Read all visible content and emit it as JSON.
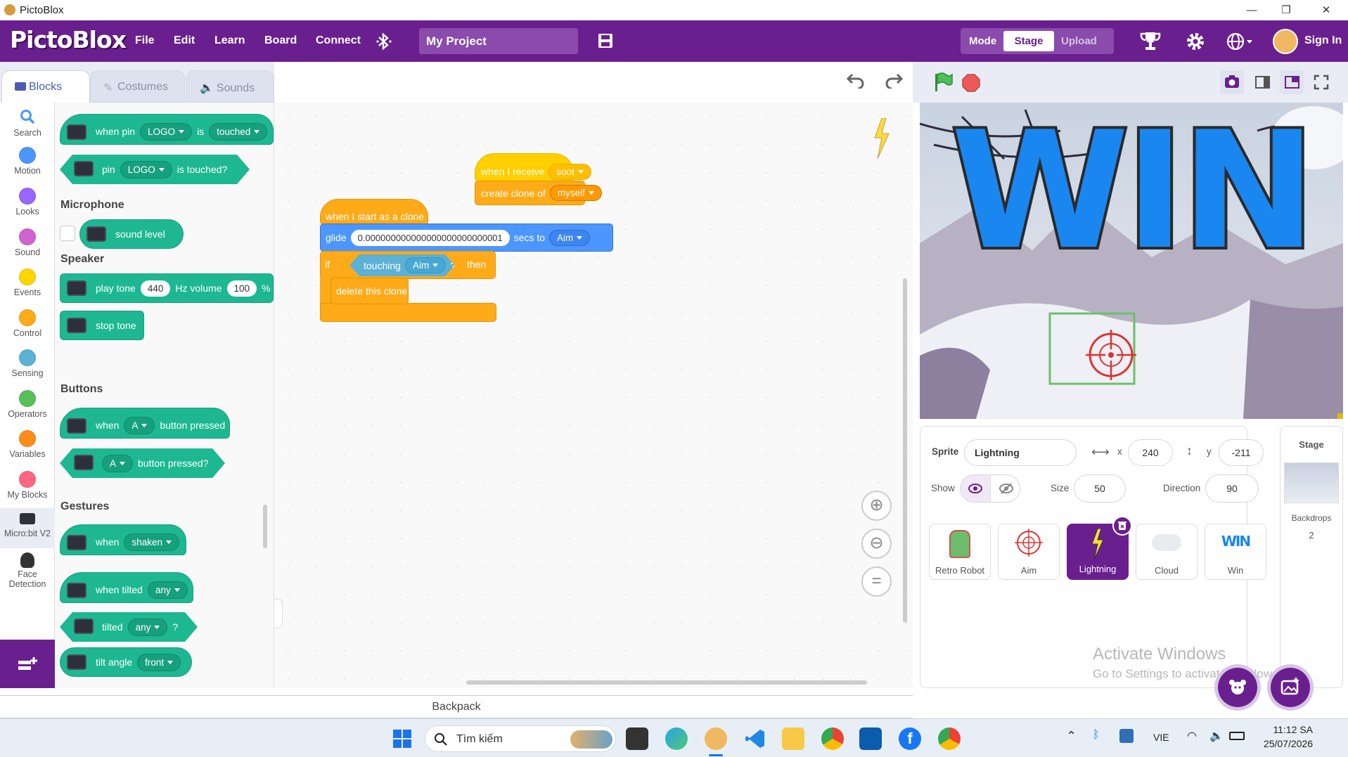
{
  "window": {
    "title": "PictoBlox",
    "controls": [
      "—",
      "❐",
      "✕"
    ]
  },
  "menubar": {
    "logo": "PictoBlox",
    "items": [
      "File",
      "Edit",
      "Learn",
      "Board",
      "Connect"
    ],
    "project_name": "My Project",
    "mode_label": "Mode",
    "mode_stage": "Stage",
    "mode_upload": "Upload",
    "sign_in": "Sign In"
  },
  "tabs": {
    "blocks": "Blocks",
    "costumes": "Costumes",
    "sounds": "Sounds"
  },
  "categories": [
    {
      "label": "Search",
      "color": "#4c97ff",
      "icon": "search-icon"
    },
    {
      "label": "Motion",
      "color": "#4c97ff"
    },
    {
      "label": "Looks",
      "color": "#9966ff"
    },
    {
      "label": "Sound",
      "color": "#cf63cf"
    },
    {
      "label": "Events",
      "color": "#ffd500"
    },
    {
      "label": "Control",
      "color": "#ffab19"
    },
    {
      "label": "Sensing",
      "color": "#5cb1d6"
    },
    {
      "label": "Operators",
      "color": "#59c059"
    },
    {
      "label": "Variables",
      "color": "#ff8c1a"
    },
    {
      "label": "My Blocks",
      "color": "#ff6680"
    },
    {
      "label": "Micro:bit V2",
      "icon": "microbit-icon"
    },
    {
      "label": "Face Detection",
      "icon": "face-icon"
    }
  ],
  "flyout": {
    "b1": {
      "a": "when pin",
      "b": "LOGO",
      "c": "is",
      "d": "touched"
    },
    "b2": {
      "a": "pin",
      "b": "LOGO",
      "c": "is touched?"
    },
    "microphone": "Microphone",
    "b3": "sound level",
    "speaker": "Speaker",
    "b4": {
      "a": "play tone",
      "b": "440",
      "c": "Hz volume",
      "d": "100",
      "e": "%"
    },
    "b5": "stop tone",
    "buttons": "Buttons",
    "b6": {
      "a": "when",
      "b": "A",
      "c": "button pressed"
    },
    "b7": {
      "b": "A",
      "c": "button pressed?"
    },
    "gestures": "Gestures",
    "b8": {
      "a": "when",
      "b": "shaken"
    },
    "b9": {
      "a": "when tilted",
      "b": "any"
    },
    "b10": {
      "a": "tilted",
      "b": "any",
      "c": "?"
    },
    "b11": {
      "a": "tilt angle",
      "b": "front"
    }
  },
  "script1": {
    "hat": "when I receive",
    "hat_dd": "soot",
    "cmd": "create clone of",
    "cmd_dd": "myself"
  },
  "script2": {
    "hat": "when I start as a clone",
    "glide": "glide",
    "glide_val": "0.000000000000000000000000001",
    "secs_to": "secs to",
    "target": "Aim",
    "if": "if",
    "touching": "touching",
    "touching_dd": "Aim",
    "q": "?",
    "then": "then",
    "delete": "delete this clone"
  },
  "backpack": "Backpack",
  "stage_art": {
    "text": "WIN",
    "color": "#1a86f0"
  },
  "sprite_info": {
    "sprite_label": "Sprite",
    "sprite_name": "Lightning",
    "x_label": "x",
    "x": "240",
    "y_label": "y",
    "y": "-211",
    "show_label": "Show",
    "size_label": "Size",
    "size": "50",
    "direction_label": "Direction",
    "direction": "90"
  },
  "sprites": [
    {
      "name": "Retro Robot",
      "selected": false
    },
    {
      "name": "Aim",
      "selected": false
    },
    {
      "name": "Lightning",
      "selected": true
    },
    {
      "name": "Cloud",
      "selected": false
    },
    {
      "name": "Win",
      "selected": false
    }
  ],
  "stage_panel": {
    "title": "Stage",
    "backdrops_label": "Backdrops",
    "backdrops_count": "2"
  },
  "watermark": {
    "line1": "Activate Windows",
    "line2": "Go to Settings to activate Windows."
  },
  "taskbar": {
    "search": "Tìm kiếm",
    "lang": "VIE",
    "time": "11:12 SA",
    "date": "25/07/2026"
  }
}
